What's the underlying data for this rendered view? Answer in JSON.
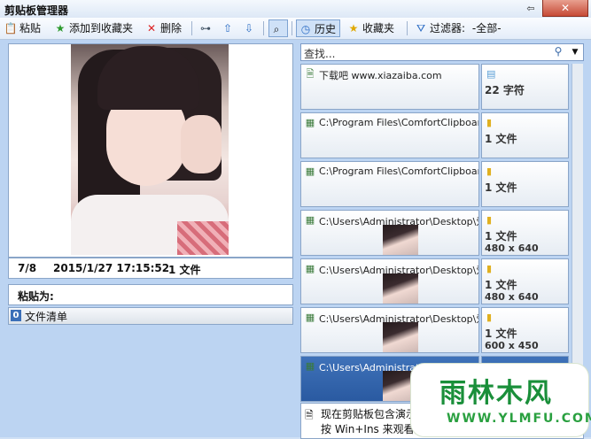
{
  "window": {
    "title": "剪贴板管理器",
    "pin": "⇦",
    "close": "✕"
  },
  "toolbar": {
    "paste": "粘贴",
    "add_favorites": "添加到收藏夹",
    "delete": "删除",
    "history": "历史",
    "favorites": "收藏夹",
    "filter_label": "过滤器:",
    "filter_value": "-全部-"
  },
  "preview": {
    "index": "7/8",
    "datetime": "2015/1/27 17:15:52",
    "count": "1 文件",
    "paste_as": "粘贴为:",
    "list_badge": "0",
    "list_label": "文件清单"
  },
  "search": {
    "placeholder": "查找..."
  },
  "items": [
    {
      "text": "下载吧 www.xiazaiba.com",
      "value": "22 字符",
      "dims": "",
      "icon": "text-file-icon",
      "rtype": "text"
    },
    {
      "text": "C:\\Program Files\\ComfortClipboard\\B",
      "value": "1 文件",
      "dims": "",
      "icon": "files-icon",
      "rtype": "folder"
    },
    {
      "text": "C:\\Program Files\\ComfortClipboard\\C",
      "value": "1 文件",
      "dims": "",
      "icon": "files-icon",
      "rtype": "folder"
    },
    {
      "text": "C:\\Users\\Administrator\\Desktop\\爱剪",
      "value": "1 文件",
      "dims": "480 x 640",
      "icon": "files-icon",
      "rtype": "folder"
    },
    {
      "text": "C:\\Users\\Administrator\\Desktop\\爱剪",
      "value": "1 文件",
      "dims": "480 x 640",
      "icon": "files-icon",
      "rtype": "folder"
    },
    {
      "text": "C:\\Users\\Administrator\\Desktop\\爱剪",
      "value": "1 文件",
      "dims": "600 x 450",
      "icon": "files-icon",
      "rtype": "folder"
    },
    {
      "text": "C:\\Users\\Administrator\\Desktop\\爱剪",
      "value": "",
      "dims": "",
      "icon": "files-icon",
      "rtype": "folder"
    }
  ],
  "status": {
    "line1": "现在剪贴板包含演示",
    "line2": "按 Win+Ins 来观看剪贴"
  },
  "watermark": {
    "brand": "雨林木风",
    "url": "WWW.YLMFU.COM"
  }
}
